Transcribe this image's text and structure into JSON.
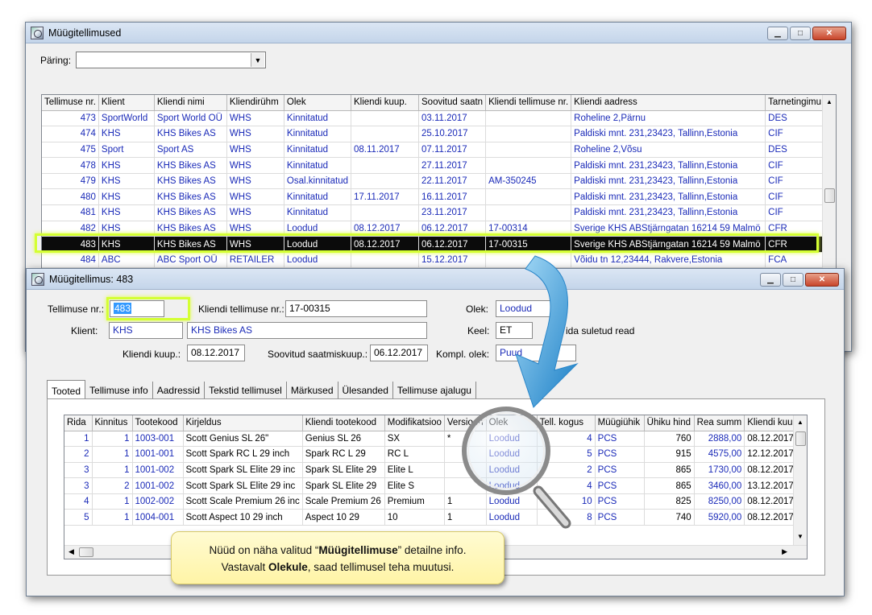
{
  "main_window": {
    "title": "Müügitellimused",
    "query_label": "Päring:",
    "query_value": "",
    "columns": [
      "Tellimuse nr.",
      "Klient",
      "Kliendi nimi",
      "Kliendirühm",
      "Olek",
      "Kliendi kuup.",
      "Soovitud saatn",
      "Kliendi tellimuse nr.",
      "Kliendi aadress",
      "Tarnetingimu"
    ],
    "rows": [
      [
        "473",
        "SportWorld",
        "Sport World OÜ",
        "WHS",
        "Kinnitatud",
        "",
        "03.11.2017",
        "",
        "Roheline 2,Pärnu",
        "DES"
      ],
      [
        "474",
        "KHS",
        "KHS Bikes AS",
        "WHS",
        "Kinnitatud",
        "",
        "25.10.2017",
        "",
        "Paldiski mnt. 231,23423, Tallinn,Estonia",
        "CIF"
      ],
      [
        "475",
        "Sport",
        "Sport AS",
        "WHS",
        "Kinnitatud",
        "08.11.2017",
        "07.11.2017",
        "",
        "Roheline 2,Võsu",
        "DES"
      ],
      [
        "478",
        "KHS",
        "KHS Bikes AS",
        "WHS",
        "Kinnitatud",
        "",
        "27.11.2017",
        "",
        "Paldiski mnt. 231,23423, Tallinn,Estonia",
        "CIF"
      ],
      [
        "479",
        "KHS",
        "KHS Bikes AS",
        "WHS",
        "Osal.kinnitatud",
        "",
        "22.11.2017",
        "AM-350245",
        "Paldiski mnt. 231,23423, Tallinn,Estonia",
        "CIF"
      ],
      [
        "480",
        "KHS",
        "KHS Bikes AS",
        "WHS",
        "Kinnitatud",
        "17.11.2017",
        "16.11.2017",
        "",
        "Paldiski mnt. 231,23423, Tallinn,Estonia",
        "CIF"
      ],
      [
        "481",
        "KHS",
        "KHS Bikes AS",
        "WHS",
        "Kinnitatud",
        "",
        "23.11.2017",
        "",
        "Paldiski mnt. 231,23423, Tallinn,Estonia",
        "CIF"
      ],
      [
        "482",
        "KHS",
        "KHS Bikes AS",
        "WHS",
        "Loodud",
        "08.12.2017",
        "06.12.2017",
        "17-00314",
        "Sverige KHS ABStjärngatan 16214 59 Malmö",
        "CFR"
      ],
      [
        "483",
        "KHS",
        "KHS Bikes AS",
        "WHS",
        "Loodud",
        "08.12.2017",
        "06.12.2017",
        "17-00315",
        "Sverige KHS ABStjärngatan 16214 59 Malmö",
        "CFR"
      ],
      [
        "484",
        "ABC",
        "ABC Sport OÜ",
        "RETAILER",
        "Loodud",
        "",
        "15.12.2017",
        "",
        "Võidu tn 12,23444, Rakvere,Estonia",
        "FCA"
      ]
    ],
    "selected_row": 8
  },
  "detail_window": {
    "title": "Müügitellimus: 483",
    "order_no_label": "Tellimuse nr.:",
    "order_no": "483",
    "client_order_label": "Kliendi tellimuse nr.:",
    "client_order_no": "17-00315",
    "status_label": "Olek:",
    "status": "Loodud",
    "client_label": "Klient:",
    "client_code": "KHS",
    "client_name": "KHS Bikes AS",
    "lang_label": "Keel:",
    "lang": "ET",
    "closed_rows_text": "ida suletud read",
    "client_date_label": "Kliendi kuup.:",
    "client_date": "08.12.2017",
    "ship_date_label": "Soovitud saatmiskuup.:",
    "ship_date": "06.12.2017",
    "compl_label": "Kompl. olek:",
    "compl_value": "Puud",
    "tabs": [
      "Tooted",
      "Tellimuse info",
      "Aadressid",
      "Tekstid tellimusel",
      "Märkused",
      "Ülesanded",
      "Tellimuse ajalugu"
    ],
    "columns": [
      "Rida",
      "Kinnitus",
      "Tootekood",
      "Kirjeldus",
      "Kliendi tootekood",
      "Modifikatsioo",
      "Versioon",
      "Olek",
      "Tell. kogus",
      "Müügiühik",
      "Ühiku hind",
      "Rea summ",
      "Kliendi kuup."
    ],
    "rows": [
      [
        "1",
        "1",
        "1003-001",
        "Scott Genius SL 26\"",
        "Genius SL 26",
        "SX",
        "*",
        "Loodud",
        "4",
        "PCS",
        "760",
        "2888,00",
        "08.12.2017"
      ],
      [
        "2",
        "1",
        "1001-001",
        "Scott Spark RC L 29 inch",
        "Spark RC L 29",
        "RC L",
        "",
        "Loodud",
        "5",
        "PCS",
        "915",
        "4575,00",
        "12.12.2017"
      ],
      [
        "3",
        "1",
        "1001-002",
        "Scott Spark SL Elite 29 inc",
        "Spark SL Elite 29",
        "Elite L",
        "",
        "Loodud",
        "2",
        "PCS",
        "865",
        "1730,00",
        "08.12.2017"
      ],
      [
        "3",
        "2",
        "1001-002",
        "Scott Spark SL Elite 29 inc",
        "Spark SL Elite 29",
        "Elite S",
        "",
        "Loodud",
        "4",
        "PCS",
        "865",
        "3460,00",
        "13.12.2017"
      ],
      [
        "4",
        "1",
        "1002-002",
        "Scott Scale Premium 26 inc",
        "Scale Premium 26",
        "Premium",
        "1",
        "Loodud",
        "10",
        "PCS",
        "825",
        "8250,00",
        "08.12.2017"
      ],
      [
        "5",
        "1",
        "1004-001",
        "Scott Aspect 10 29 inch",
        "Aspect 10 29",
        "10",
        "1",
        "Loodud",
        "8",
        "PCS",
        "740",
        "5920,00",
        "08.12.2017"
      ]
    ]
  },
  "callout": {
    "line1_pre": "Nüüd on näha valitud “",
    "line1_bold": "Müügitellimuse",
    "line1_post": "” detailne info.",
    "line2_pre": "Vastavalt ",
    "line2_bold": "Olekule",
    "line2_post": ", saad tellimusel teha muutusi."
  },
  "colors": {
    "accent_blue": "#1a2ab8",
    "highlight": "#d4ff33",
    "callout_bg": "#fff6b0"
  },
  "icons": [
    "app-icon",
    "minimize-icon",
    "maximize-icon",
    "close-icon",
    "chevron-down-icon",
    "magnifier-icon",
    "arrow-curve-icon"
  ]
}
